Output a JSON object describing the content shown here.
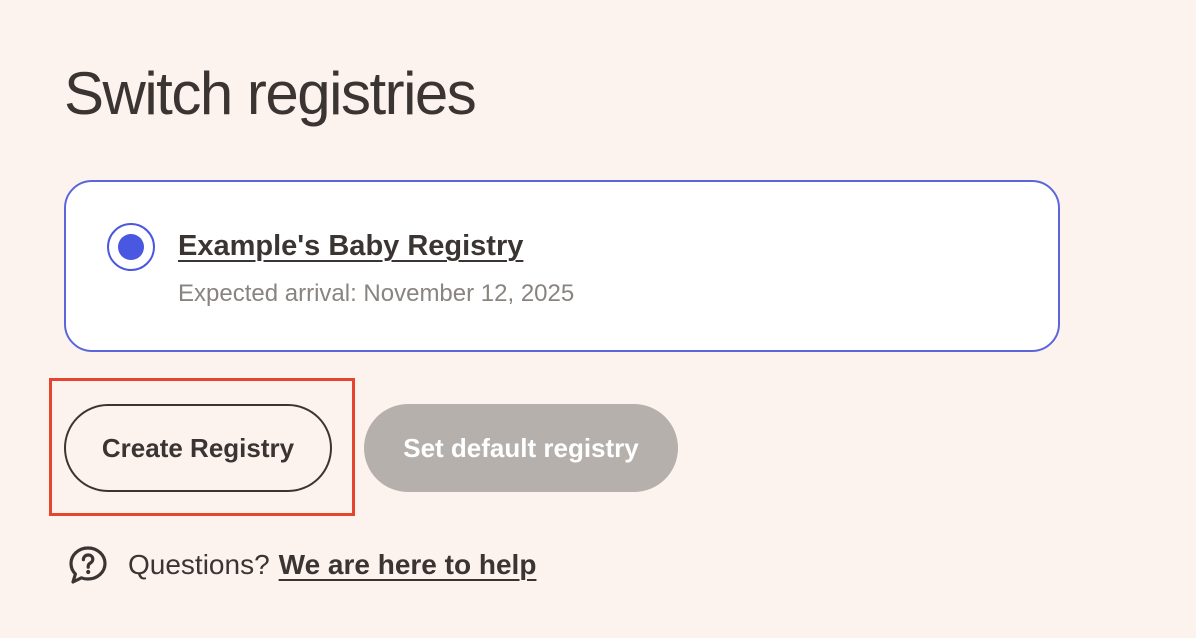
{
  "page": {
    "title": "Switch registries"
  },
  "registries": [
    {
      "name": "Example's Baby Registry",
      "subtitle": "Expected arrival: November 12, 2025",
      "selected": true
    }
  ],
  "actions": {
    "create_label": "Create Registry",
    "set_default_label": "Set default registry",
    "set_default_disabled": true
  },
  "help": {
    "prefix": "Questions?",
    "link_label": "We are here to help",
    "icon": "question-chat-icon"
  },
  "colors": {
    "background": "#fcf3ef",
    "accent": "#4a57e0",
    "card_border": "#5b66dd",
    "disabled_button": "#b5b0ac",
    "highlight": "#e5452f",
    "text": "#3a3532"
  }
}
